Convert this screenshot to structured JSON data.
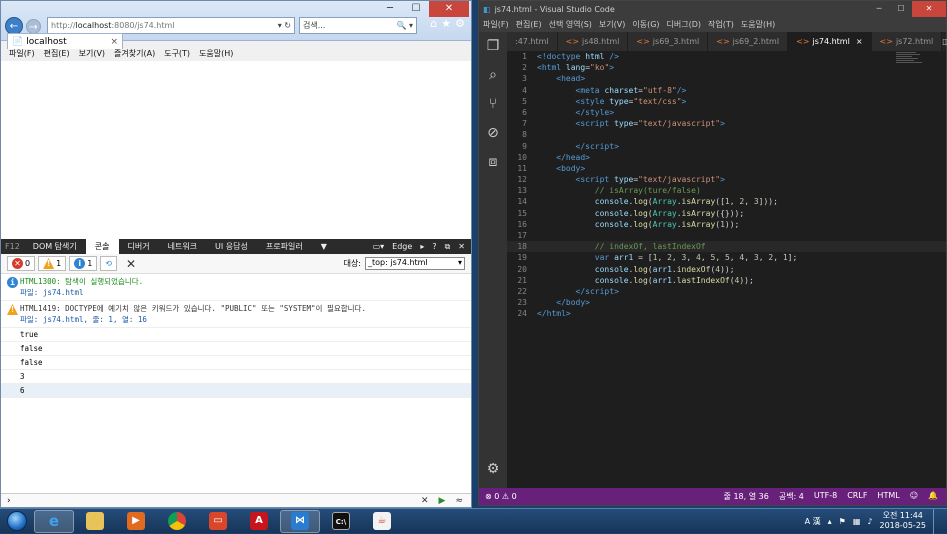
{
  "ie": {
    "address_host": "http://",
    "address_bold": "localhost",
    "address_rest": ":8080/js74.html",
    "address_tail": "▾ ↻",
    "search_placeholder": "검색...",
    "search_tail": "🔍 ▾",
    "tab_title": "localhost",
    "menu": [
      "파일(F)",
      "편집(E)",
      "보기(V)",
      "즐겨찾기(A)",
      "도구(T)",
      "도움말(H)"
    ]
  },
  "f12": {
    "label": "F12",
    "tabs": [
      "DOM 탐색기",
      "콘솔",
      "디버거",
      "네트워크",
      "UI 응답성",
      "프로파일러"
    ],
    "mode": "Edge",
    "counts": {
      "errors": "0",
      "warnings": "1",
      "info": "1"
    },
    "target_label": "대상:",
    "target_value": "_top: js74.html",
    "messages": [
      {
        "type": "info",
        "text": "HTML1300: 탐색이 실행되었습니다.",
        "sub": "파일: js74.html"
      },
      {
        "type": "warn",
        "text": "HTML1419: DOCTYPE에 예기치 않은 키워드가 있습니다. \"PUBLIC\" 또는 \"SYSTEM\"이 필요합니다.",
        "sub": "파일: js74.html, 줄: 1, 열: 16"
      }
    ],
    "outputs": [
      "true",
      "false",
      "false",
      "3",
      "6"
    ],
    "prompt": "›"
  },
  "vscode": {
    "title": "js74.html - Visual Studio Code",
    "menu": [
      "파일(F)",
      "편집(E)",
      "선택 영역(S)",
      "보기(V)",
      "이동(G)",
      "디버그(D)",
      "작업(T)",
      "도움말(H)"
    ],
    "tabs": [
      ":47.html",
      "js48.html",
      "js69_3.html",
      "js69_2.html",
      "js74.html",
      "js72.html"
    ],
    "active_tab": "js74.html",
    "status": {
      "problems": "⊗ 0 ⚠ 0",
      "position": "줄 18, 열 36",
      "spaces": "공백: 4",
      "encoding": "UTF-8",
      "eol": "CRLF",
      "language": "HTML"
    }
  },
  "taskbar": {
    "lang": "A 漢",
    "time": "오전 11:44",
    "date": "2018-05-25"
  }
}
